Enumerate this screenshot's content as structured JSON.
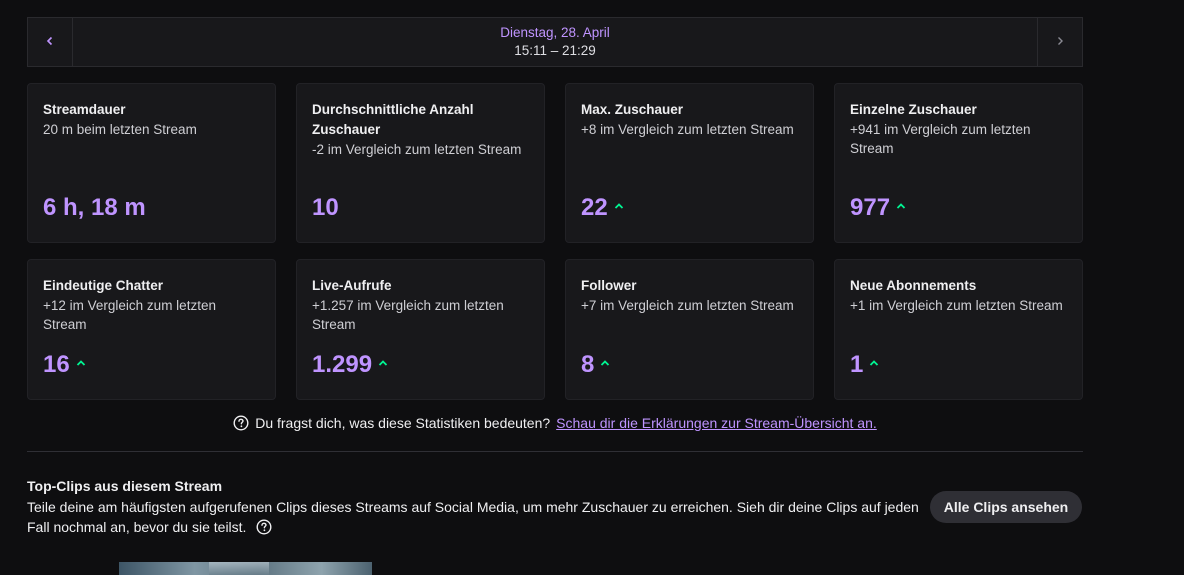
{
  "datebar": {
    "prev_icon": "chevron-left-icon",
    "next_icon": "chevron-right-icon",
    "date": "Dienstag, 28. April",
    "time_range": "15:11 – 21:29"
  },
  "colors": {
    "accent": "#bf94ff",
    "up_arrow": "#00f593",
    "card_bg": "#18181b",
    "page_bg": "#0e0e10"
  },
  "stats": [
    {
      "title": "Streamdauer",
      "subtitle": "20 m beim letzten Stream",
      "value": "6 h, 18 m",
      "trend": "none"
    },
    {
      "title": "Durchschnittliche Anzahl Zuschauer",
      "subtitle": "-2 im Vergleich zum letzten Stream",
      "value": "10",
      "trend": "none"
    },
    {
      "title": "Max. Zuschauer",
      "subtitle": "+8 im Vergleich zum letzten Stream",
      "value": "22",
      "trend": "up"
    },
    {
      "title": "Einzelne Zuschauer",
      "subtitle": "+941 im Vergleich zum letzten Stream",
      "value": "977",
      "trend": "up"
    },
    {
      "title": "Eindeutige Chatter",
      "subtitle": "+12 im Vergleich zum letzten Stream",
      "value": "16",
      "trend": "up"
    },
    {
      "title": "Live-Aufrufe",
      "subtitle": "+1.257 im Vergleich zum letzten Stream",
      "value": "1.299",
      "trend": "up"
    },
    {
      "title": "Follower",
      "subtitle": "+7 im Vergleich zum letzten Stream",
      "value": "8",
      "trend": "up"
    },
    {
      "title": "Neue Abonnements",
      "subtitle": "+1 im Vergleich zum letzten Stream",
      "value": "1",
      "trend": "up"
    }
  ],
  "info": {
    "question": "Du fragst dich, was diese Statistiken bedeuten?",
    "link": "Schau dir die Erklärungen zur Stream-Übersicht an."
  },
  "clips": {
    "title": "Top-Clips aus diesem Stream",
    "description": "Teile deine am häufigsten aufgerufenen Clips dieses Streams auf Social Media, um mehr Zuschauer zu erreichen. Sieh dir deine Clips auf jeden Fall nochmal an, bevor du sie teilst.",
    "button": "Alle Clips ansehen"
  }
}
